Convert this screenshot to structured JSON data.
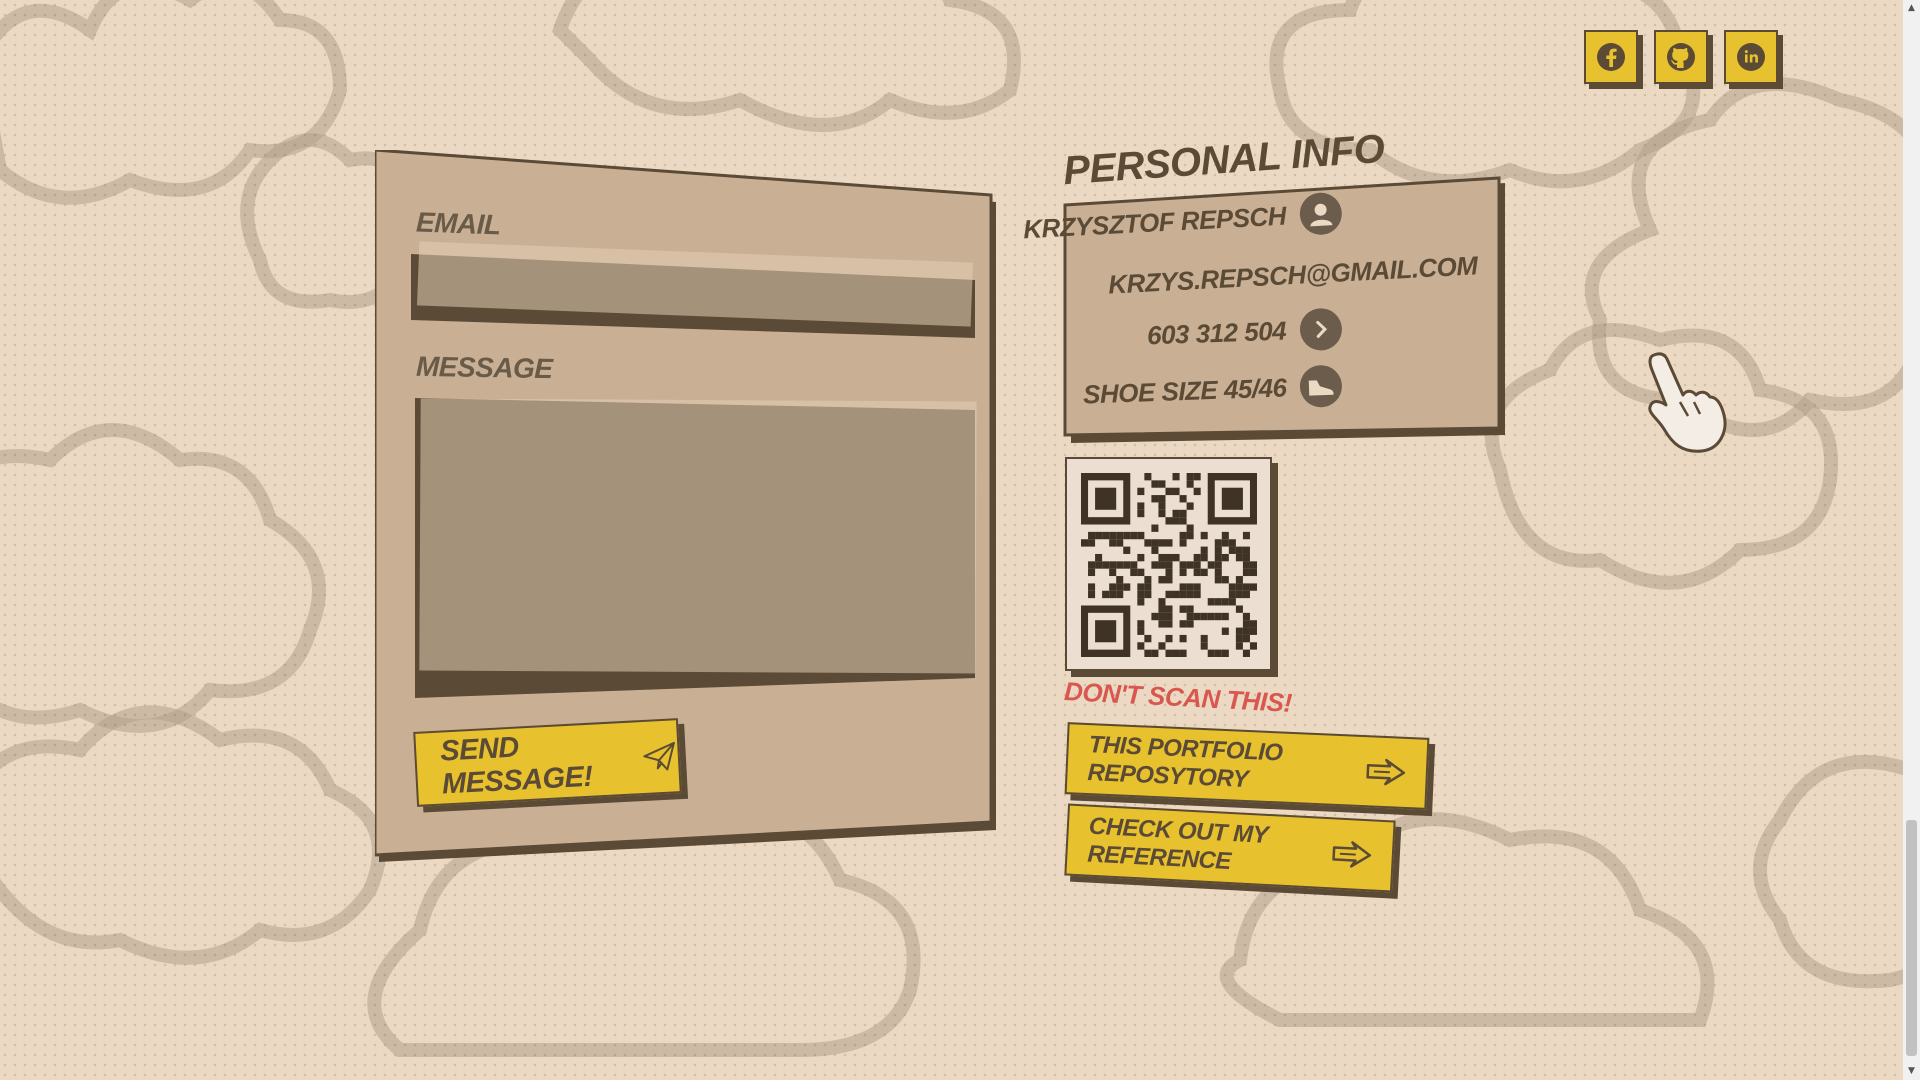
{
  "colors": {
    "background": "#ecd9c4",
    "panel": "#c9b095",
    "accent": "#e7c22e",
    "ink": "#5b4a35",
    "warning": "#d8574e"
  },
  "social": [
    {
      "name": "facebook",
      "icon": "facebook-icon"
    },
    {
      "name": "github",
      "icon": "github-icon"
    },
    {
      "name": "linkedin",
      "icon": "linkedin-icon"
    }
  ],
  "form": {
    "email_label": "Email",
    "email_value": "",
    "message_label": "Message",
    "message_value": "",
    "send_label": "Send message!",
    "send_icon": "paper-plane-icon"
  },
  "personal_info": {
    "title": "Personal info",
    "name": "Krzysztof Repsch",
    "email": "krzys.repsch@gmail.com",
    "phone": "603 312 504",
    "shoe": "Shoe size 45/46",
    "icons": [
      "user-icon",
      "chevron-right-icon",
      "shoe-icon"
    ]
  },
  "qr": {
    "warning": "Don't scan this!"
  },
  "links": {
    "repo_label": "This portfolio reposytory",
    "reference_label": "Check out my reference"
  },
  "scrollbar": {
    "up": "▲",
    "down": "▼"
  }
}
